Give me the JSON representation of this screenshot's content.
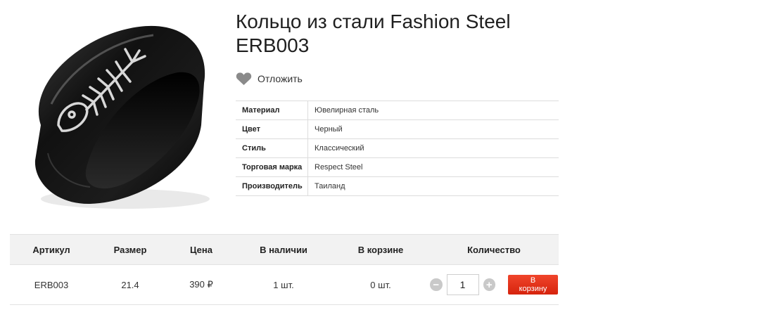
{
  "product": {
    "title_line1": "Кольцо из стали Fashion Steel",
    "title_line2": "ERB003"
  },
  "wishlist": {
    "label": "Отложить",
    "icon": "heart-icon"
  },
  "specs": [
    {
      "key": "Материал",
      "value": "Ювелирная сталь"
    },
    {
      "key": "Цвет",
      "value": "Черный"
    },
    {
      "key": "Стиль",
      "value": "Классический"
    },
    {
      "key": "Торговая марка",
      "value": "Respect Steel"
    },
    {
      "key": "Производитель",
      "value": "Таиланд"
    }
  ],
  "offers": {
    "headers": [
      "Артикул",
      "Размер",
      "Цена",
      "В наличии",
      "В корзине",
      "Количество"
    ],
    "row": {
      "sku": "ERB003",
      "size": "21.4",
      "price": "390 ₽",
      "stock": "1 шт.",
      "in_cart": "0 шт.",
      "quantity": "1"
    },
    "decrement_icon": "minus-circle-icon",
    "increment_icon": "plus-circle-icon",
    "cart_button": "В корзину"
  },
  "colors": {
    "accent": "#e2341b",
    "header_bg": "#f2f2f2"
  }
}
